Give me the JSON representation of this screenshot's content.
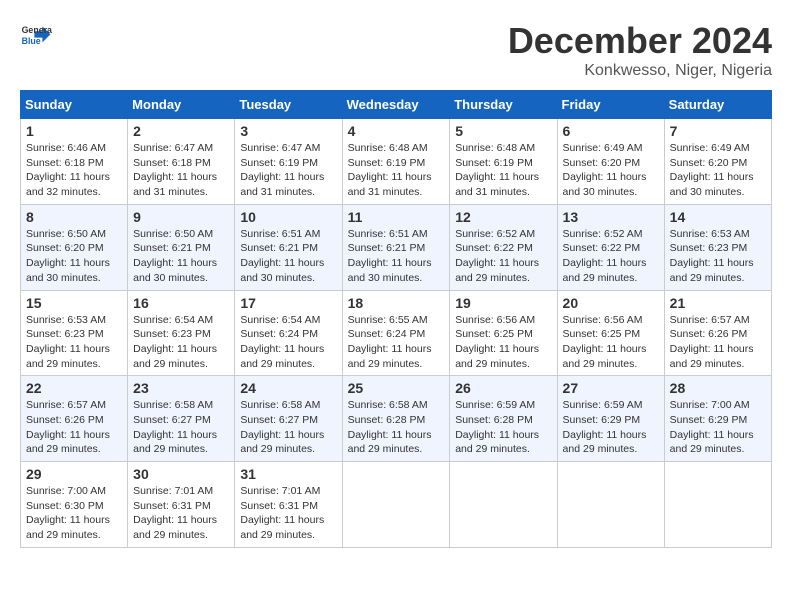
{
  "logo": {
    "line1": "General",
    "line2": "Blue"
  },
  "title": {
    "month": "December 2024",
    "location": "Konkwesso, Niger, Nigeria"
  },
  "headers": [
    "Sunday",
    "Monday",
    "Tuesday",
    "Wednesday",
    "Thursday",
    "Friday",
    "Saturday"
  ],
  "weeks": [
    [
      {
        "day": "1",
        "info": "Sunrise: 6:46 AM\nSunset: 6:18 PM\nDaylight: 11 hours\nand 32 minutes."
      },
      {
        "day": "2",
        "info": "Sunrise: 6:47 AM\nSunset: 6:18 PM\nDaylight: 11 hours\nand 31 minutes."
      },
      {
        "day": "3",
        "info": "Sunrise: 6:47 AM\nSunset: 6:19 PM\nDaylight: 11 hours\nand 31 minutes."
      },
      {
        "day": "4",
        "info": "Sunrise: 6:48 AM\nSunset: 6:19 PM\nDaylight: 11 hours\nand 31 minutes."
      },
      {
        "day": "5",
        "info": "Sunrise: 6:48 AM\nSunset: 6:19 PM\nDaylight: 11 hours\nand 31 minutes."
      },
      {
        "day": "6",
        "info": "Sunrise: 6:49 AM\nSunset: 6:20 PM\nDaylight: 11 hours\nand 30 minutes."
      },
      {
        "day": "7",
        "info": "Sunrise: 6:49 AM\nSunset: 6:20 PM\nDaylight: 11 hours\nand 30 minutes."
      }
    ],
    [
      {
        "day": "8",
        "info": "Sunrise: 6:50 AM\nSunset: 6:20 PM\nDaylight: 11 hours\nand 30 minutes."
      },
      {
        "day": "9",
        "info": "Sunrise: 6:50 AM\nSunset: 6:21 PM\nDaylight: 11 hours\nand 30 minutes."
      },
      {
        "day": "10",
        "info": "Sunrise: 6:51 AM\nSunset: 6:21 PM\nDaylight: 11 hours\nand 30 minutes."
      },
      {
        "day": "11",
        "info": "Sunrise: 6:51 AM\nSunset: 6:21 PM\nDaylight: 11 hours\nand 30 minutes."
      },
      {
        "day": "12",
        "info": "Sunrise: 6:52 AM\nSunset: 6:22 PM\nDaylight: 11 hours\nand 29 minutes."
      },
      {
        "day": "13",
        "info": "Sunrise: 6:52 AM\nSunset: 6:22 PM\nDaylight: 11 hours\nand 29 minutes."
      },
      {
        "day": "14",
        "info": "Sunrise: 6:53 AM\nSunset: 6:23 PM\nDaylight: 11 hours\nand 29 minutes."
      }
    ],
    [
      {
        "day": "15",
        "info": "Sunrise: 6:53 AM\nSunset: 6:23 PM\nDaylight: 11 hours\nand 29 minutes."
      },
      {
        "day": "16",
        "info": "Sunrise: 6:54 AM\nSunset: 6:23 PM\nDaylight: 11 hours\nand 29 minutes."
      },
      {
        "day": "17",
        "info": "Sunrise: 6:54 AM\nSunset: 6:24 PM\nDaylight: 11 hours\nand 29 minutes."
      },
      {
        "day": "18",
        "info": "Sunrise: 6:55 AM\nSunset: 6:24 PM\nDaylight: 11 hours\nand 29 minutes."
      },
      {
        "day": "19",
        "info": "Sunrise: 6:56 AM\nSunset: 6:25 PM\nDaylight: 11 hours\nand 29 minutes."
      },
      {
        "day": "20",
        "info": "Sunrise: 6:56 AM\nSunset: 6:25 PM\nDaylight: 11 hours\nand 29 minutes."
      },
      {
        "day": "21",
        "info": "Sunrise: 6:57 AM\nSunset: 6:26 PM\nDaylight: 11 hours\nand 29 minutes."
      }
    ],
    [
      {
        "day": "22",
        "info": "Sunrise: 6:57 AM\nSunset: 6:26 PM\nDaylight: 11 hours\nand 29 minutes."
      },
      {
        "day": "23",
        "info": "Sunrise: 6:58 AM\nSunset: 6:27 PM\nDaylight: 11 hours\nand 29 minutes."
      },
      {
        "day": "24",
        "info": "Sunrise: 6:58 AM\nSunset: 6:27 PM\nDaylight: 11 hours\nand 29 minutes."
      },
      {
        "day": "25",
        "info": "Sunrise: 6:58 AM\nSunset: 6:28 PM\nDaylight: 11 hours\nand 29 minutes."
      },
      {
        "day": "26",
        "info": "Sunrise: 6:59 AM\nSunset: 6:28 PM\nDaylight: 11 hours\nand 29 minutes."
      },
      {
        "day": "27",
        "info": "Sunrise: 6:59 AM\nSunset: 6:29 PM\nDaylight: 11 hours\nand 29 minutes."
      },
      {
        "day": "28",
        "info": "Sunrise: 7:00 AM\nSunset: 6:29 PM\nDaylight: 11 hours\nand 29 minutes."
      }
    ],
    [
      {
        "day": "29",
        "info": "Sunrise: 7:00 AM\nSunset: 6:30 PM\nDaylight: 11 hours\nand 29 minutes."
      },
      {
        "day": "30",
        "info": "Sunrise: 7:01 AM\nSunset: 6:31 PM\nDaylight: 11 hours\nand 29 minutes."
      },
      {
        "day": "31",
        "info": "Sunrise: 7:01 AM\nSunset: 6:31 PM\nDaylight: 11 hours\nand 29 minutes."
      },
      {
        "day": "",
        "info": ""
      },
      {
        "day": "",
        "info": ""
      },
      {
        "day": "",
        "info": ""
      },
      {
        "day": "",
        "info": ""
      }
    ]
  ]
}
